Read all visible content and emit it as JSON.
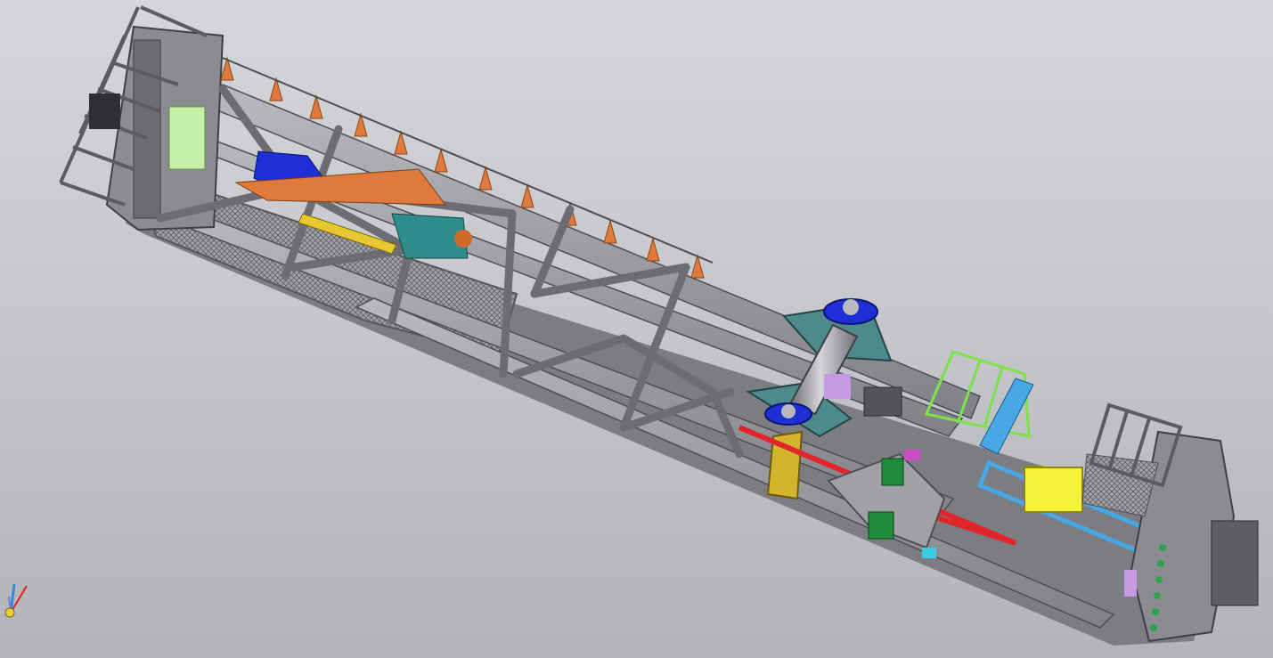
{
  "viewport": {
    "background_top": "#d4d6da",
    "background_bottom": "#b2b4b8"
  },
  "model": {
    "steel_color": "#8e9096",
    "steel_dark": "#55575c",
    "mesh_color": "#6d6f74",
    "accent_colors": {
      "hydraulic_blue": "#1e2fd6",
      "guard_yellow": "#e8c830",
      "bright_yellow": "#f6f23a",
      "cable_red": "#e0262a",
      "light_blue": "#48a8e6",
      "lime_rail": "#7ee04a",
      "orange_cone": "#e07a3c",
      "green_block": "#1e8c3a",
      "teal": "#2e8c8c",
      "violet": "#c89ae6",
      "light_green_panel": "#c6f0a6"
    }
  },
  "axis_triad": {
    "icon": "axis-triad-icon",
    "x_color": "#e02020",
    "y_color": "#2a8ee0",
    "z_color": "#e8d030"
  }
}
